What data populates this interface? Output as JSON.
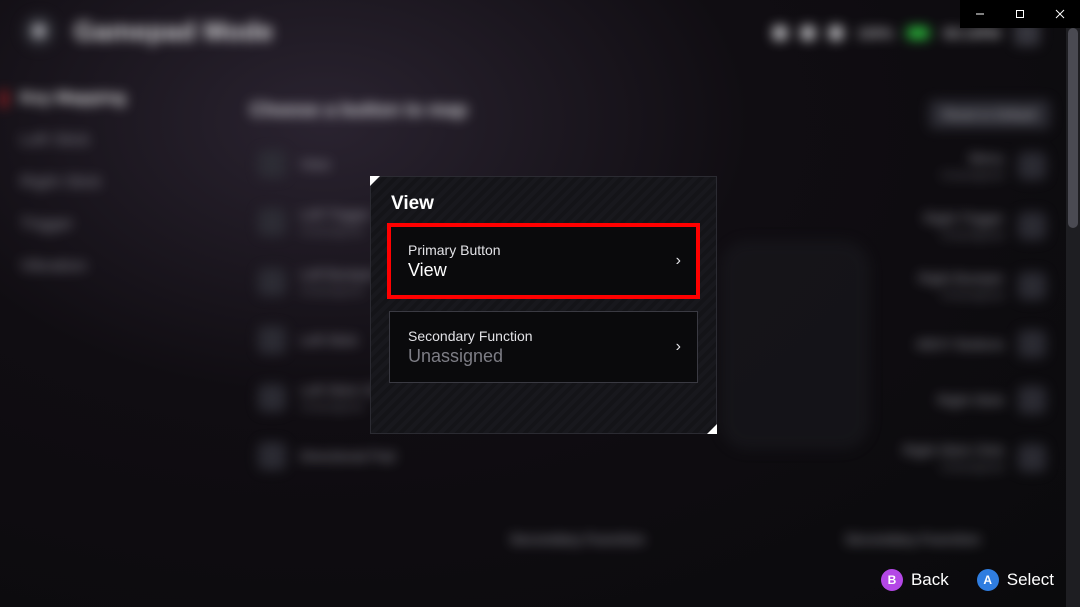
{
  "window": {
    "minimize": "—",
    "maximize": "□",
    "close": "✕"
  },
  "header": {
    "title": "Gamepad Mode",
    "battery_pct": "100%",
    "time": "06:14PM"
  },
  "sidebar": {
    "items": [
      {
        "label": "Key Mapping"
      },
      {
        "label": "Left Stick"
      },
      {
        "label": "Right Stick"
      },
      {
        "label": "Trigger"
      },
      {
        "label": "Vibration"
      }
    ]
  },
  "subheader": "Choose a button to map",
  "reset_btn": "Reset to Default",
  "bg_left": [
    {
      "name": "View",
      "sub": ""
    },
    {
      "name": "Left Trigger",
      "sub": "Unassigned"
    },
    {
      "name": "Left Bumper",
      "sub": "Unassigned"
    },
    {
      "name": "Left Stick",
      "sub": ""
    },
    {
      "name": "Left Stick Click",
      "sub": "Unassigned"
    },
    {
      "name": "Directional Pad",
      "sub": ""
    }
  ],
  "bg_right": [
    {
      "name": "Menu",
      "sub": "Unassigned"
    },
    {
      "name": "Right Trigger",
      "sub": "Unassigned"
    },
    {
      "name": "Right Bumper",
      "sub": "Unassigned"
    },
    {
      "name": "ABXY Buttons",
      "sub": ""
    },
    {
      "name": "Right Stick",
      "sub": ""
    },
    {
      "name": "Right Stick Click",
      "sub": "Unassigned"
    }
  ],
  "bottom_fn_left": "Secondary Function",
  "bottom_fn_right": "Secondary Function",
  "modal": {
    "title": "View",
    "primary": {
      "label": "Primary Button",
      "value": "View"
    },
    "secondary": {
      "label": "Secondary Function",
      "value": "Unassigned"
    }
  },
  "prompts": {
    "back": "Back",
    "select": "Select"
  }
}
